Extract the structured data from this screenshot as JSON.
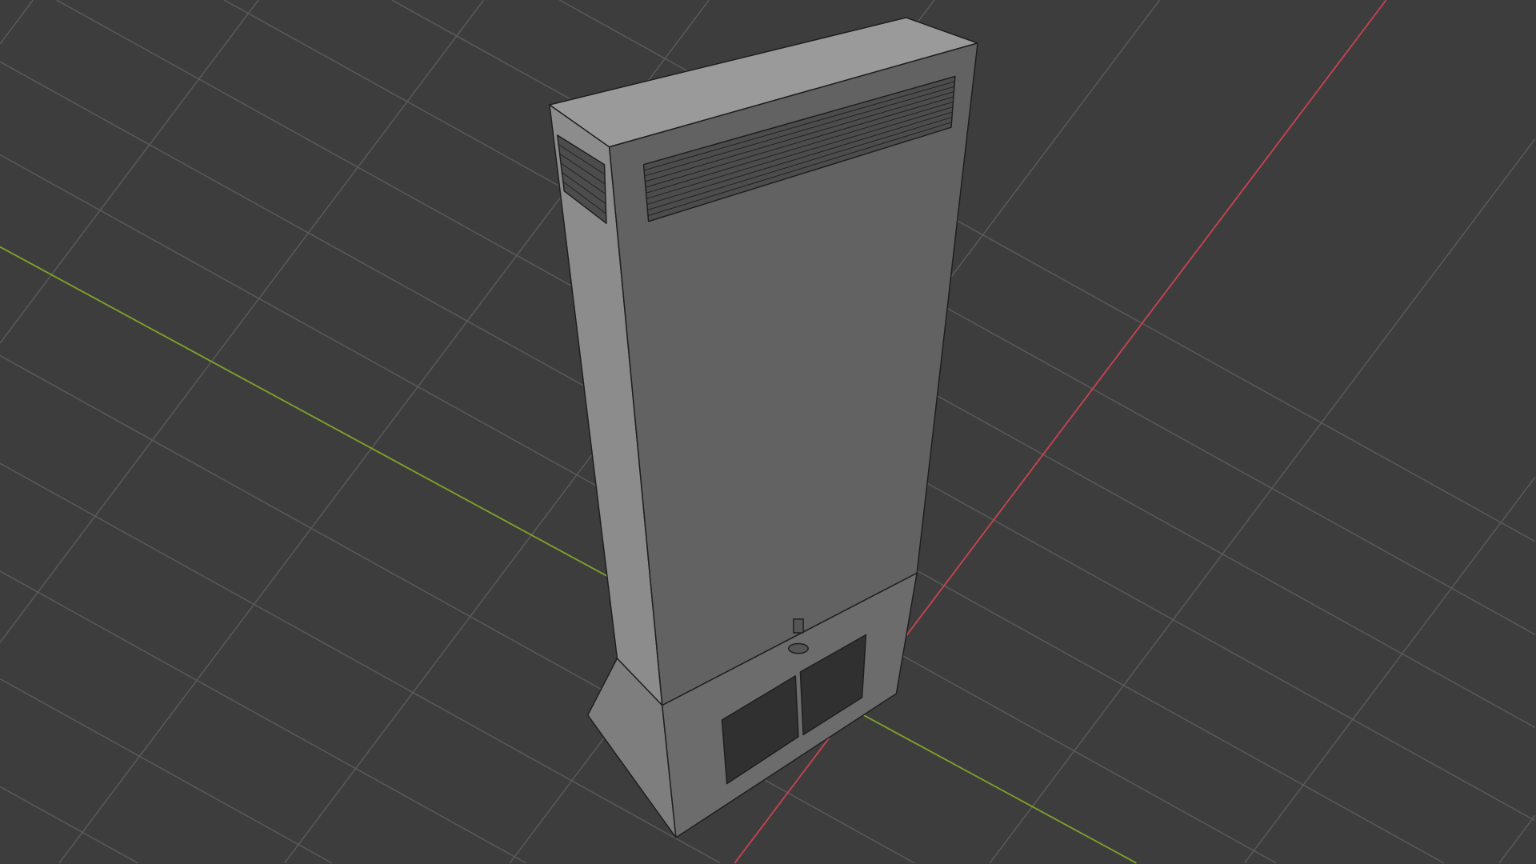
{
  "viewport": {
    "background": "#3d3d3d",
    "grid_color": "#555555",
    "x_axis_color": "#c8424f",
    "y_axis_color": "#7fa22a",
    "model_color": "#8a8a8a"
  }
}
